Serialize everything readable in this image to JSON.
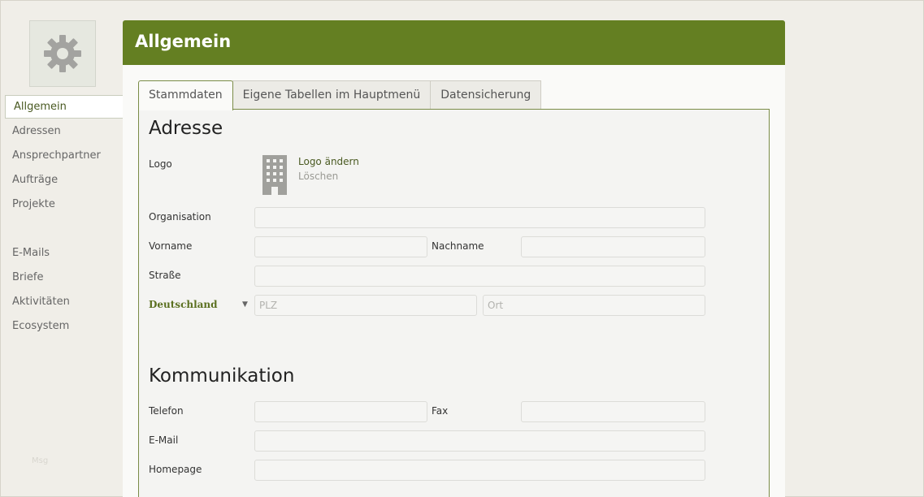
{
  "header": {
    "title": "Allgemein"
  },
  "sidebar": {
    "items": [
      {
        "label": "Allgemein"
      },
      {
        "label": "Adressen"
      },
      {
        "label": "Ansprechpartner"
      },
      {
        "label": "Aufträge"
      },
      {
        "label": "Projekte"
      },
      {
        "label": "E-Mails"
      },
      {
        "label": "Briefe"
      },
      {
        "label": "Aktivitäten"
      },
      {
        "label": "Ecosystem"
      }
    ],
    "footer": "Msg"
  },
  "tabs": [
    {
      "label": "Stammdaten"
    },
    {
      "label": "Eigene Tabellen im Hauptmenü"
    },
    {
      "label": "Datensicherung"
    }
  ],
  "address": {
    "title": "Adresse",
    "logo_label": "Logo",
    "logo_change": "Logo ändern",
    "logo_delete": "Löschen",
    "organisation_label": "Organisation",
    "vorname_label": "Vorname",
    "nachname_label": "Nachname",
    "strasse_label": "Straße",
    "country": "Deutschland",
    "plz_placeholder": "PLZ",
    "ort_placeholder": "Ort"
  },
  "communication": {
    "title": "Kommunikation",
    "telefon_label": "Telefon",
    "fax_label": "Fax",
    "email_label": "E-Mail",
    "homepage_label": "Homepage"
  }
}
